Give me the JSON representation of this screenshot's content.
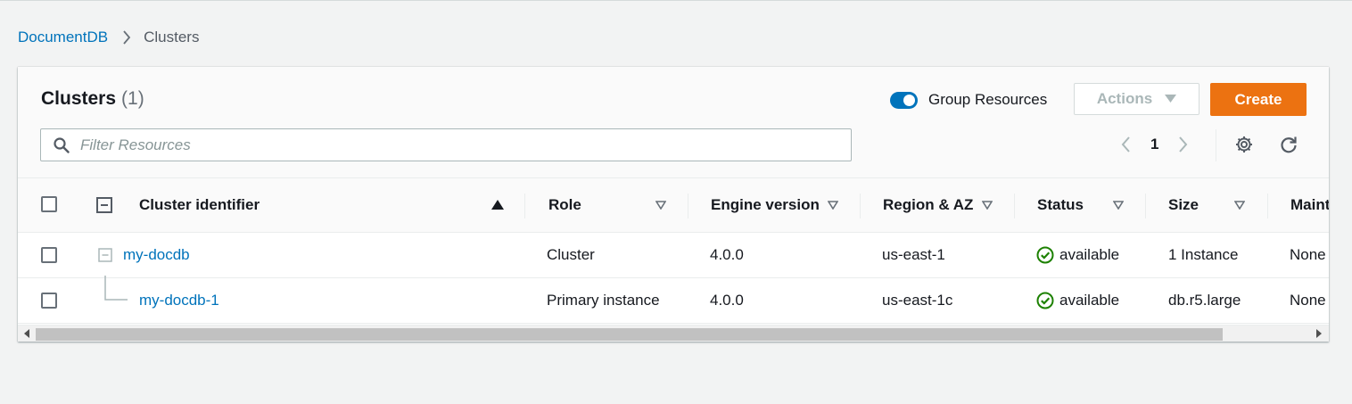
{
  "breadcrumb": {
    "root": "DocumentDB",
    "current": "Clusters"
  },
  "header": {
    "title": "Clusters",
    "count": "(1)",
    "group_resources_label": "Group Resources",
    "group_resources_on": true,
    "actions_label": "Actions",
    "create_label": "Create"
  },
  "search": {
    "placeholder": "Filter Resources",
    "value": ""
  },
  "pagination": {
    "current_page": "1"
  },
  "table": {
    "columns": [
      "Cluster identifier",
      "Role",
      "Engine version",
      "Region & AZ",
      "Status",
      "Size",
      "Maint"
    ],
    "rows": [
      {
        "identifier": "my-docdb",
        "role": "Cluster",
        "engine": "4.0.0",
        "region": "us-east-1",
        "status": "available",
        "size": "1 Instance",
        "maint": "None"
      },
      {
        "identifier": "my-docdb-1",
        "role": "Primary instance",
        "engine": "4.0.0",
        "region": "us-east-1c",
        "status": "available",
        "size": "db.r5.large",
        "maint": "None"
      }
    ]
  },
  "colors": {
    "link": "#0073bb",
    "accent": "#ec7211",
    "success": "#1d8102",
    "toggle": "#0073bb"
  }
}
